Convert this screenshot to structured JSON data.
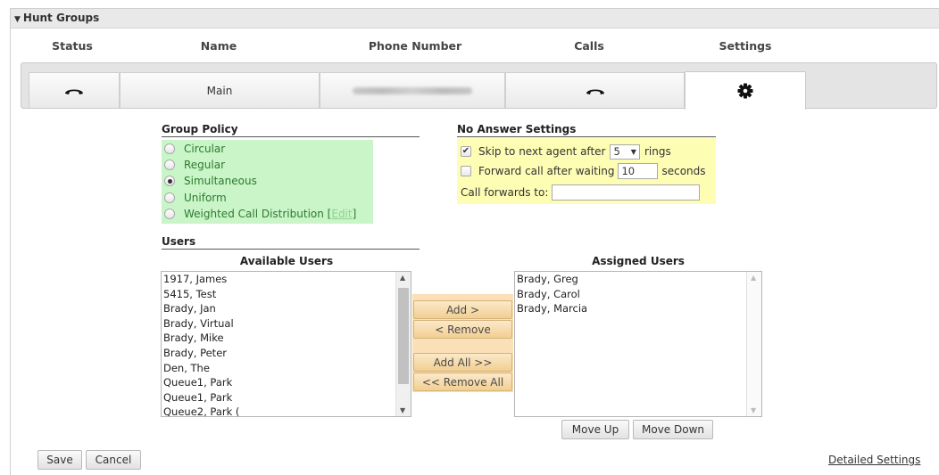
{
  "panel": {
    "title": "Hunt Groups"
  },
  "columns": {
    "status": "Status",
    "name": "Name",
    "phone": "Phone Number",
    "calls": "Calls",
    "settings": "Settings"
  },
  "row": {
    "status_icon": "phone-handset-icon",
    "name": "Main",
    "phone": "",
    "calls_icon": "phone-handset-icon",
    "settings_icon": "gear-icon"
  },
  "group_policy": {
    "title": "Group Policy",
    "options": [
      {
        "label": "Circular",
        "selected": false
      },
      {
        "label": "Regular",
        "selected": false
      },
      {
        "label": "Simultaneous",
        "selected": true
      },
      {
        "label": "Uniform",
        "selected": false
      },
      {
        "label": "Weighted Call Distribution",
        "selected": false
      }
    ],
    "edit_open": "[",
    "edit_label": "Edit",
    "edit_close": "]"
  },
  "no_answer": {
    "title": "No Answer Settings",
    "skip_label_before": "Skip to next agent after",
    "skip_value": "5",
    "skip_label_after": "rings",
    "skip_checked": true,
    "forward_label_before": "Forward call after waiting",
    "forward_value": "10",
    "forward_label_after": "seconds",
    "forward_checked": false,
    "forwards_to_label": "Call forwards to:",
    "forwards_to_value": ""
  },
  "users": {
    "title": "Users",
    "available_title": "Available Users",
    "assigned_title": "Assigned Users",
    "available": [
      "1917, James",
      "5415, Test",
      "Brady, Jan",
      "Brady, Virtual",
      "Brady, Mike",
      "Brady, Peter",
      "Den, The",
      "Queue1, Park",
      "Queue1, Park",
      "Queue2, Park ("
    ],
    "assigned": [
      "Brady, Greg",
      "Brady, Carol",
      "Brady, Marcia"
    ],
    "add": "Add >",
    "remove": "< Remove",
    "add_all": "Add All >>",
    "remove_all": "<< Remove All",
    "move_up": "Move Up",
    "move_down": "Move Down"
  },
  "footer": {
    "save": "Save",
    "cancel": "Cancel",
    "detailed": "Detailed Settings"
  },
  "colors": {
    "policy_bg": "#c9f5c9",
    "no_answer_bg": "#fdfdb4",
    "transfer_bg": "#fbe0b7"
  }
}
